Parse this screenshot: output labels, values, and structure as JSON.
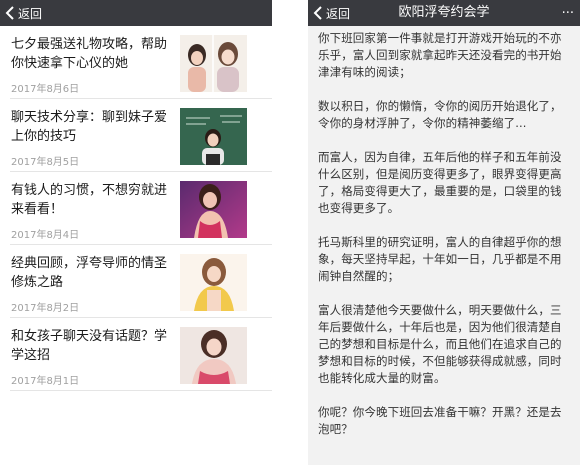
{
  "left": {
    "nav": {
      "back_label": "返回"
    },
    "articles": [
      {
        "title": "七夕最强送礼物攻略，帮助你快速拿下心仪的她",
        "date": "2017年8月6日"
      },
      {
        "title": "聊天技术分享：聊到妹子爱上你的技巧",
        "date": "2017年8月5日"
      },
      {
        "title": "有钱人的习惯，不想穷就进来看看！",
        "date": "2017年8月4日"
      },
      {
        "title": "经典回顾，浮夸导师的情圣修炼之路",
        "date": "2017年8月2日"
      },
      {
        "title": "和女孩子聊天没有话题？学学这招",
        "date": "2017年8月1日"
      }
    ]
  },
  "right": {
    "nav": {
      "back_label": "返回",
      "title": "欧阳浮夸约会学",
      "more_label": "···"
    },
    "paragraphs": [
      "你下班回家第一件事就是打开游戏开始玩的不亦乐乎，富人回到家就拿起昨天还没看完的书开始津津有味的阅读；",
      "数以积日，你的懒惰，令你的阅历开始退化了，令你的身材浮肿了，令你的精神萎缩了...",
      "而富人，因为自律，五年后他的样子和五年前没什么区别，但是阅历变得更多了，眼界变得更高了，格局变得更大了，最重要的是，口袋里的钱也变得更多了。",
      "托马斯科里的研究证明，富人的自律超乎你的想象，每天坚持早起，十年如一日，几乎都是不用闹钟自然醒的；",
      "富人很清楚他今天要做什么，明天要做什么，三年后要做什么，十年后也是，因为他们很清楚自己的梦想和目标是什么，而且他们在追求自己的梦想和目标的时候，不但能够获得成就感，同时也能转化成大量的财富。",
      "你呢？你今晚下班回去准备干嘛？开黑？还是去泡吧？"
    ]
  },
  "colors": {
    "navbar": "#393a3f",
    "divider": "#e5e5e5",
    "date": "#a0a0a0",
    "background_right": "#f2f2f2"
  },
  "icons": {
    "back": "chevron-left-icon",
    "more": "more-dots-icon"
  }
}
